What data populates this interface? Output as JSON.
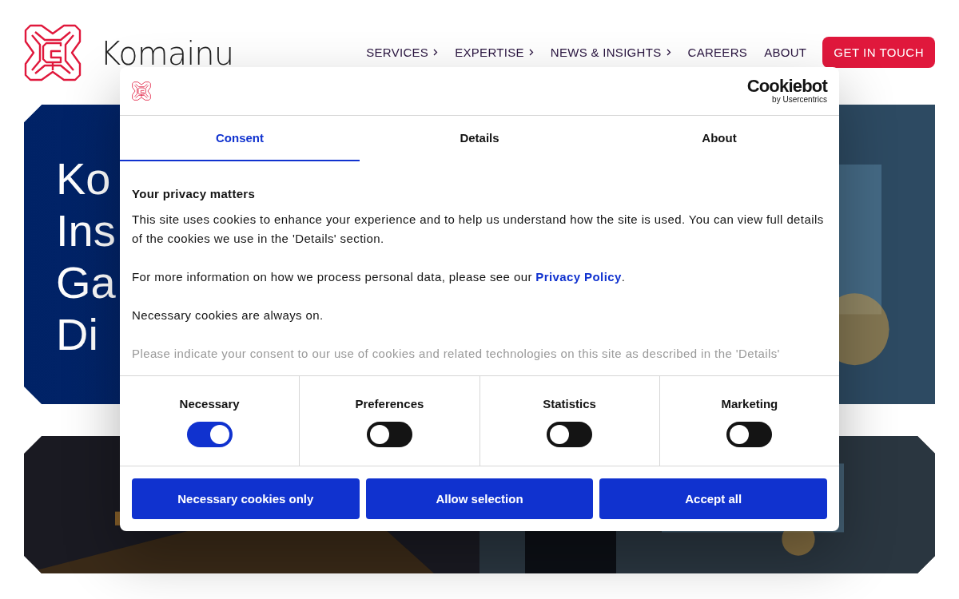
{
  "header": {
    "logo_text": "Komainu",
    "nav": [
      {
        "label": "SERVICES",
        "has_submenu": true
      },
      {
        "label": "EXPERTISE",
        "has_submenu": true
      },
      {
        "label": "NEWS & INSIGHTS",
        "has_submenu": true
      },
      {
        "label": "CAREERS",
        "has_submenu": false
      },
      {
        "label": "ABOUT",
        "has_submenu": false
      }
    ],
    "cta": "GET IN TOUCH"
  },
  "hero": {
    "heading_lines": [
      "Ko",
      "Ins",
      "Ga",
      "Di"
    ]
  },
  "cookie_dialog": {
    "brand": "Cookiebot",
    "brand_sub": "by Usercentrics",
    "tabs": [
      {
        "label": "Consent",
        "selected": true
      },
      {
        "label": "Details",
        "selected": false
      },
      {
        "label": "About",
        "selected": false
      }
    ],
    "title": "Your privacy matters",
    "paragraphs": [
      {
        "text": "This site uses cookies to enhance your experience and to help us understand how the site is used. You can view full details of the cookies we use in the 'Details' section."
      },
      {
        "text": "For more information on how we process personal data, please see our ",
        "link": "Privacy Policy",
        "after": "."
      },
      {
        "text": "Necessary cookies are always on."
      }
    ],
    "faded_text": "Please indicate your consent to our use of cookies and related technologies on this site as described in the 'Details'",
    "toggles": [
      {
        "label": "Necessary",
        "checked": true
      },
      {
        "label": "Preferences",
        "checked": false
      },
      {
        "label": "Statistics",
        "checked": false
      },
      {
        "label": "Marketing",
        "checked": false
      }
    ],
    "buttons": [
      "Necessary cookies only",
      "Allow selection",
      "Accept all"
    ]
  }
}
